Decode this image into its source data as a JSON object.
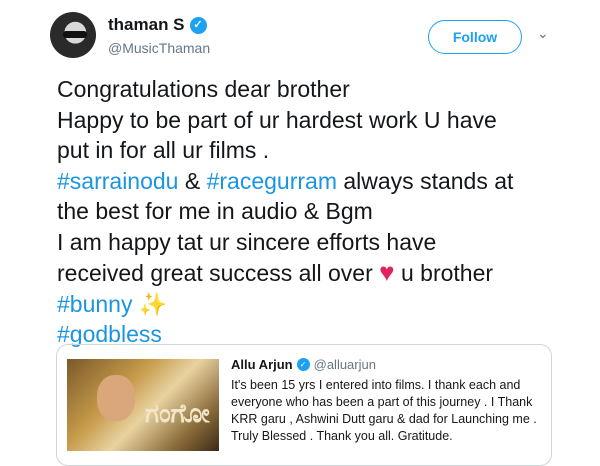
{
  "author": {
    "name": "thaman S",
    "handle": "@MusicThaman",
    "verified_mark": "✓"
  },
  "follow_button": {
    "label": "Follow"
  },
  "menu": {
    "chevron": "⌄"
  },
  "tweet": {
    "line1": "Congratulations dear brother",
    "line2": "Happy to be part of ur hardest work U have",
    "line3": "put in for all ur films .",
    "line4_hashtag1": "#sarrainodu",
    "line4_mid": " & ",
    "line4_hashtag2": "#racegurram",
    "line4_end": " always stands at",
    "line5": "the best for me in audio & Bgm",
    "line6": "I am happy tat ur sincere efforts have",
    "line7_start": "received great success all over ",
    "heart": "♥",
    "line7_end": " u brother",
    "hashtag_bunny": "#bunny",
    "sparkles": "✨",
    "hashtag_godbless": "#godbless"
  },
  "quoted_tweet": {
    "name": "Allu Arjun",
    "verified_mark": "✓",
    "handle": "@alluarjun",
    "text": "It's been 15 yrs I entered into films. I thank each and everyone who has been a part of this journey . I Thank  KRR garu , Ashwini Dutt garu & dad for Launching me . Truly Blessed . Thank you all. Gratitude.",
    "image_logo": "ಗಂಗೋ"
  },
  "colors": {
    "accent": "#1da1f2",
    "hashtag": "#1b95e0",
    "heart": "#e0245e",
    "secondary_text": "#657786"
  }
}
